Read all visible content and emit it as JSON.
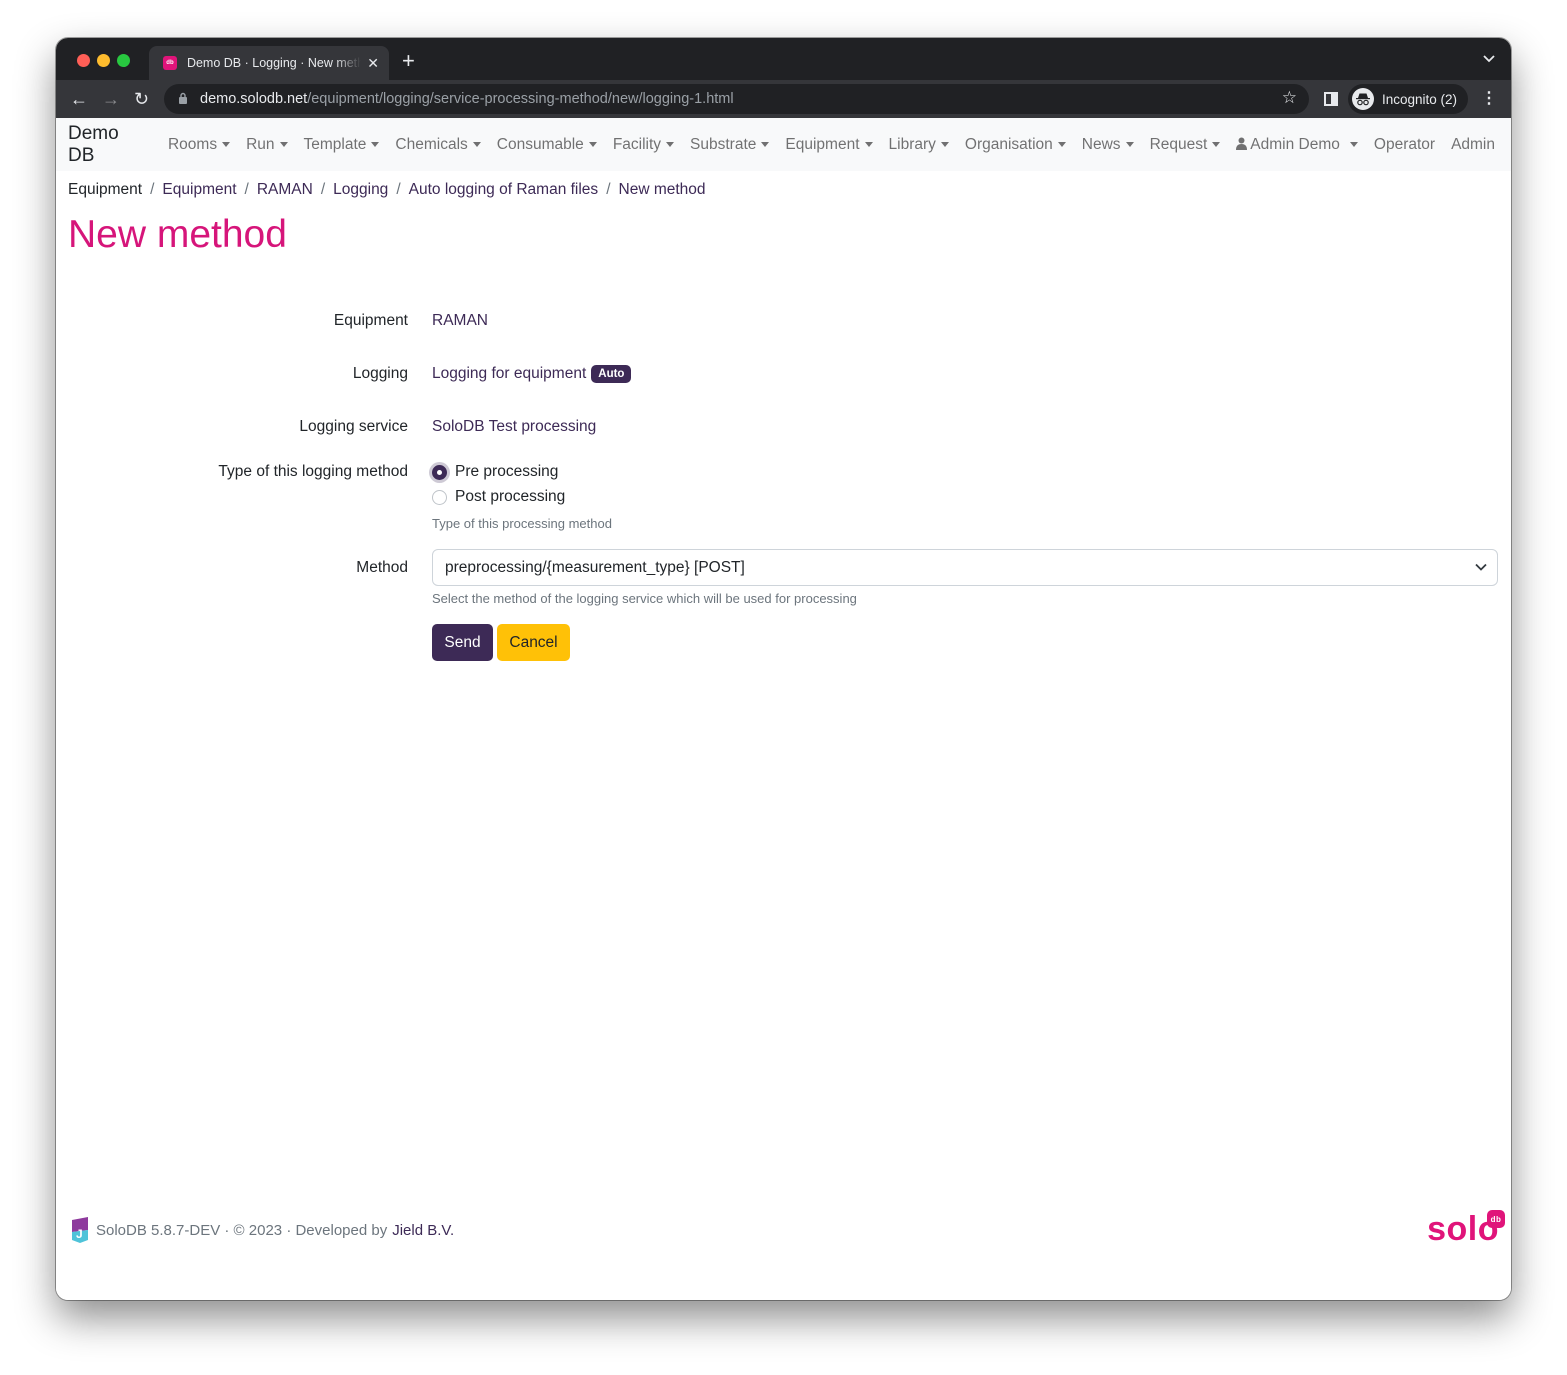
{
  "browser": {
    "tab_title": "Demo DB · Logging · New method",
    "tab_close": "✕",
    "new_tab": "+",
    "tab_menu": "⌄",
    "url_host": "demo.solodb.net",
    "url_path": "/equipment/logging/service-processing-method/new/logging-1.html",
    "profile_label": "Incognito (2)",
    "icons": {
      "back": "←",
      "forward": "→",
      "reload": "↻",
      "lock": "🔒",
      "star": "☆",
      "incognito": "🕶",
      "menu": "⋮",
      "favicon": "db"
    }
  },
  "navbar": {
    "brand": "Demo DB",
    "items": [
      {
        "label": "Rooms"
      },
      {
        "label": "Run"
      },
      {
        "label": "Template"
      },
      {
        "label": "Chemicals"
      },
      {
        "label": "Consumable"
      },
      {
        "label": "Facility"
      },
      {
        "label": "Substrate"
      },
      {
        "label": "Equipment"
      },
      {
        "label": "Library"
      },
      {
        "label": "Organisation"
      },
      {
        "label": "News"
      },
      {
        "label": "Request"
      }
    ],
    "user_label": "Admin Demo",
    "operator_label": "Operator",
    "admin_label": "Admin"
  },
  "breadcrumb": [
    {
      "label": "Equipment"
    },
    {
      "label": "Equipment"
    },
    {
      "label": "RAMAN"
    },
    {
      "label": "Logging"
    },
    {
      "label": "Auto logging of Raman files"
    },
    {
      "label": "New method"
    }
  ],
  "breadcrumb_separator": "/",
  "page_title": "New method",
  "form": {
    "equipment_label": "Equipment",
    "equipment_value": "RAMAN",
    "logging_label": "Logging",
    "logging_value": "Logging for equipment",
    "logging_badge": "Auto",
    "service_label": "Logging service",
    "service_value": "SoloDB Test processing",
    "type_label": "Type of this logging method",
    "type_options": [
      {
        "label": "Pre processing",
        "checked": true
      },
      {
        "label": "Post processing",
        "checked": false
      }
    ],
    "type_help": "Type of this processing method",
    "method_label": "Method",
    "method_selected": "preprocessing/{measurement_type} [POST]",
    "method_help": "Select the method of the logging service which will be used for processing",
    "send_label": "Send",
    "cancel_label": "Cancel"
  },
  "footer": {
    "text": "SoloDB 5.8.7-DEV · © 2023 · Developed by",
    "link": "Jield B.V.",
    "logo_text": "solo",
    "logo_badge": "db"
  },
  "colors": {
    "primary": "#3d2a56",
    "accent": "#d6157a",
    "warning": "#ffc107"
  }
}
